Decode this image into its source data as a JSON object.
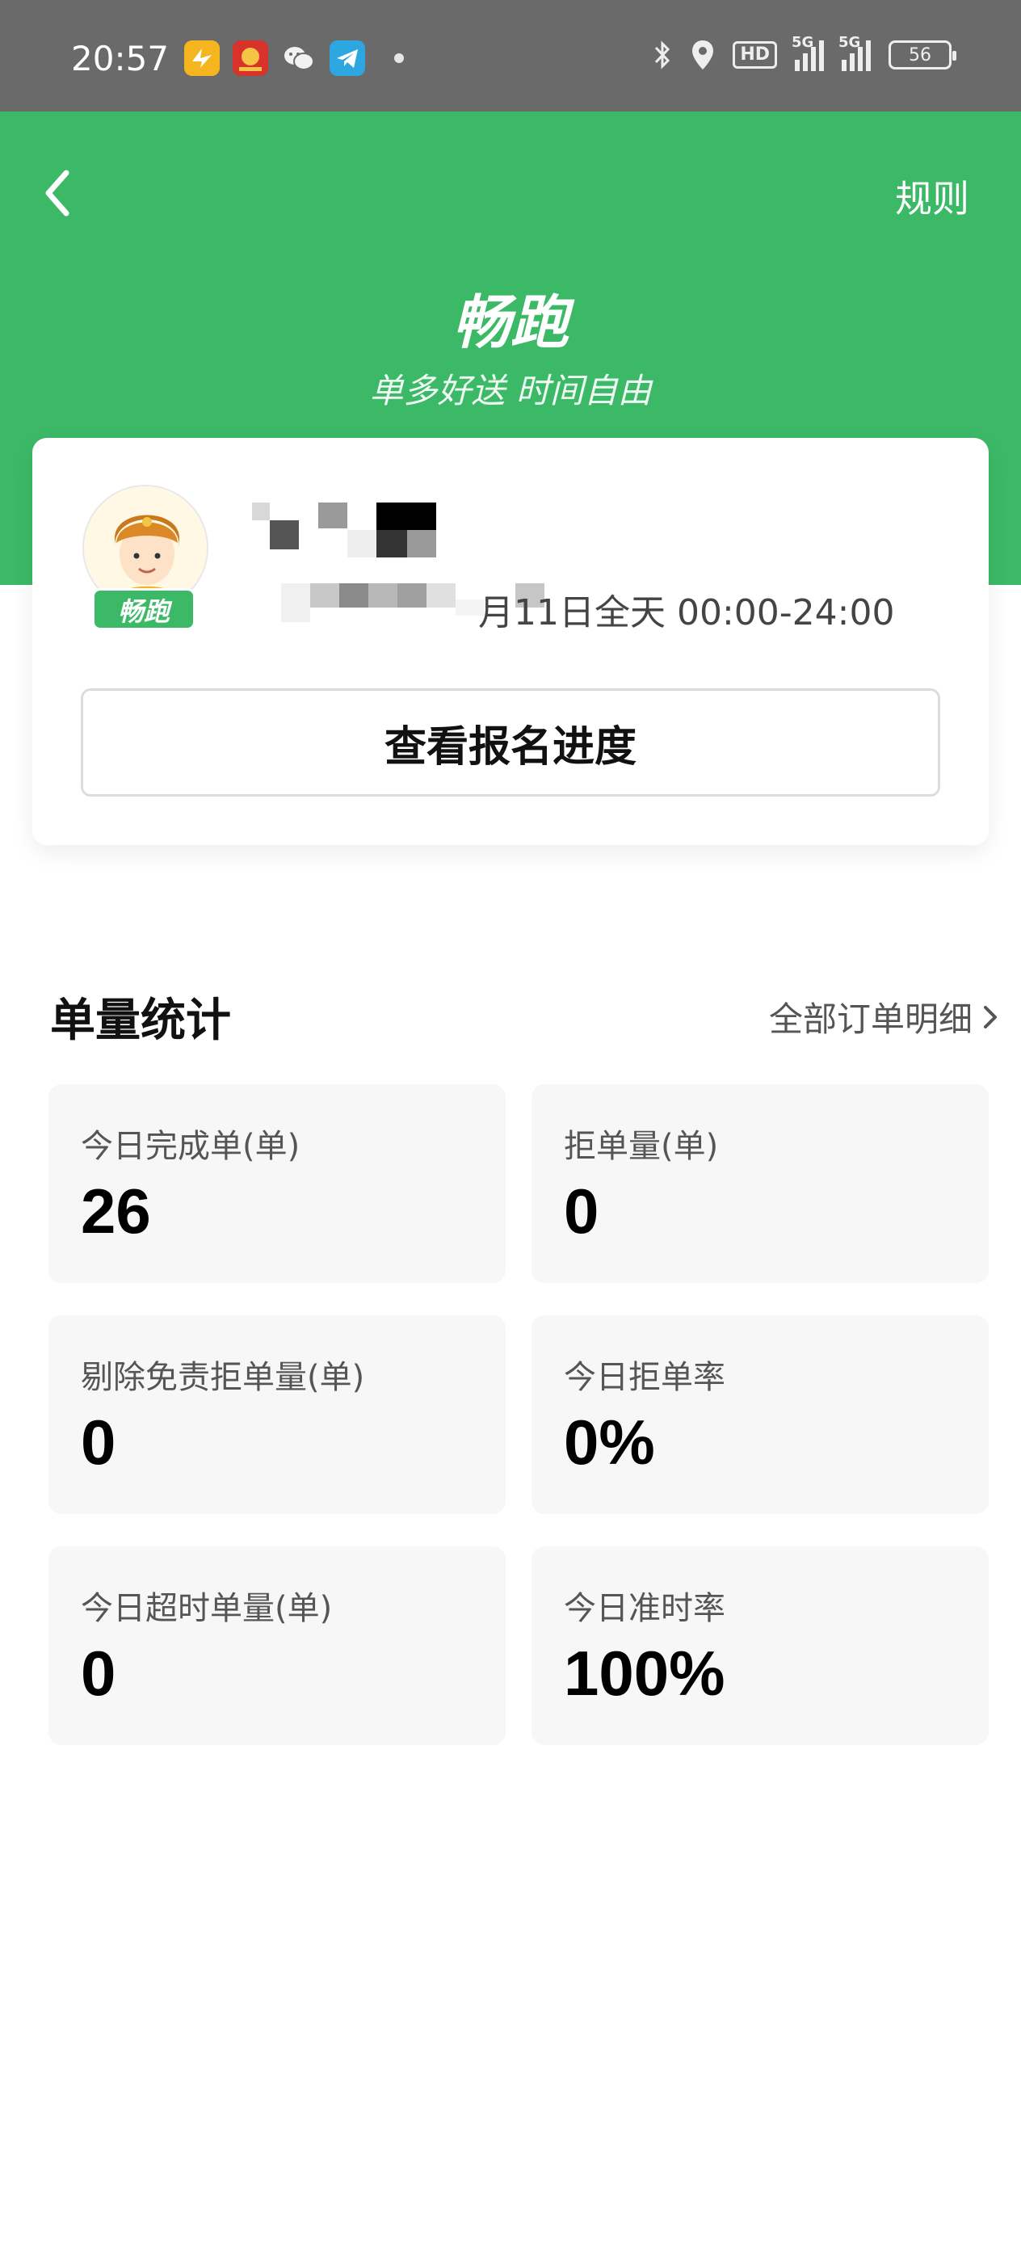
{
  "status_bar": {
    "time": "20:57",
    "app_icons": [
      "taobao-flash-icon",
      "app-red-icon",
      "wechat-icon",
      "telegram-icon"
    ],
    "indicators": [
      "bluetooth-icon",
      "location-icon",
      "hd-icon",
      "signal-5g-icon",
      "signal-5g-icon"
    ],
    "hd_label": "HD",
    "signal_tag": "5G",
    "battery": "56"
  },
  "header": {
    "back_icon": "chevron-left-icon",
    "rules_label": "规则",
    "title": "畅跑",
    "subtitle": "单多好送 时间自由",
    "color": "#3bb966"
  },
  "profile": {
    "avatar_tag": "畅跑",
    "schedule_text": "月11日全天 00:00-24:00",
    "progress_button": "查看报名进度"
  },
  "stats": {
    "title": "单量统计",
    "all_orders_link": "全部订单明细",
    "cards": [
      {
        "label": "今日完成单(单)",
        "value": "26"
      },
      {
        "label": "拒单量(单)",
        "value": "0"
      },
      {
        "label": "剔除免责拒单量(单)",
        "value": "0"
      },
      {
        "label": "今日拒单率",
        "value": "0%"
      },
      {
        "label": "今日超时单量(单)",
        "value": "0"
      },
      {
        "label": "今日准时率",
        "value": "100%"
      }
    ]
  }
}
